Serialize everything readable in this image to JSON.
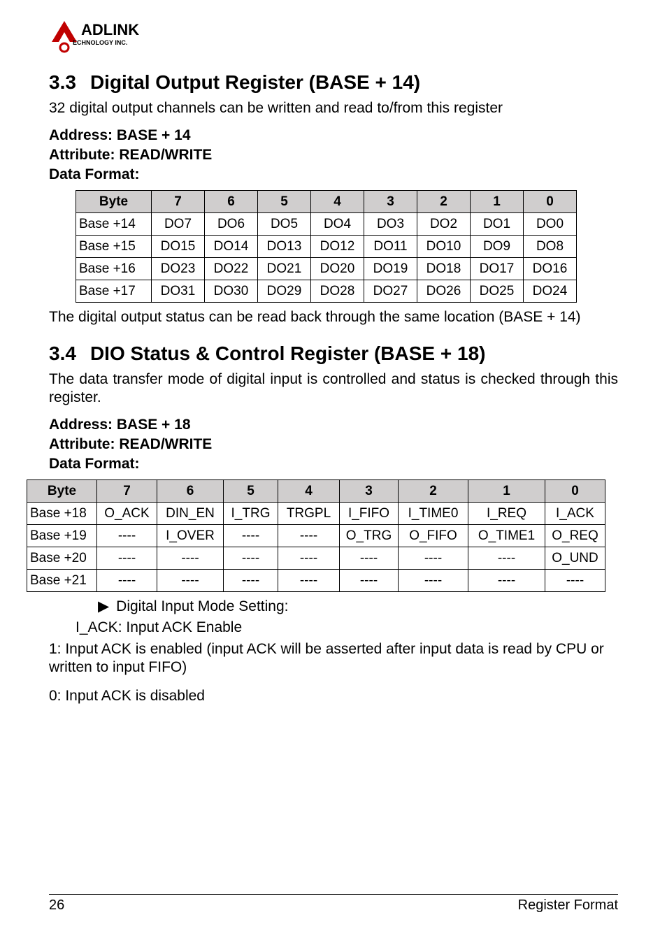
{
  "logo": {
    "line1": "ADLINK",
    "line2": "ECHNOLOGY INC."
  },
  "sec33": {
    "num": "3.3",
    "title": "Digital Output Register (BASE + 14)",
    "intro": "32 digital output channels can be written and read to/from this register",
    "addr_label": "Address: BASE + 14",
    "attr_label": "Attribute: READ/WRITE",
    "df_label": "Data Format:",
    "table_header": [
      "Byte",
      "7",
      "6",
      "5",
      "4",
      "3",
      "2",
      "1",
      "0"
    ],
    "rows": [
      [
        "Base +14",
        "DO7",
        "DO6",
        "DO5",
        "DO4",
        "DO3",
        "DO2",
        "DO1",
        "DO0"
      ],
      [
        "Base +15",
        "DO15",
        "DO14",
        "DO13",
        "DO12",
        "DO11",
        "DO10",
        "DO9",
        "DO8"
      ],
      [
        "Base +16",
        "DO23",
        "DO22",
        "DO21",
        "DO20",
        "DO19",
        "DO18",
        "DO17",
        "DO16"
      ],
      [
        "Base +17",
        "DO31",
        "DO30",
        "DO29",
        "DO28",
        "DO27",
        "DO26",
        "DO25",
        "DO24"
      ]
    ],
    "post": "The digital output status can be read back through the same location (BASE + 14)"
  },
  "sec34": {
    "num": "3.4",
    "title": "DIO Status & Control Register (BASE + 18)",
    "intro": "The data transfer mode of digital input is controlled and status is checked through this register.",
    "addr_label": "Address: BASE + 18",
    "attr_label": "Attribute: READ/WRITE",
    "df_label": "Data Format:",
    "table_header": [
      "Byte",
      "7",
      "6",
      "5",
      "4",
      "3",
      "2",
      "1",
      "0"
    ],
    "rows": [
      [
        "Base +18",
        "O_ACK",
        "DIN_EN",
        "I_TRG",
        "TRGPL",
        "I_FIFO",
        "I_TIME0",
        "I_REQ",
        "I_ACK"
      ],
      [
        "Base +19",
        "----",
        "I_OVER",
        "----",
        "----",
        "O_TRG",
        "O_FIFO",
        "O_TIME1",
        "O_REQ"
      ],
      [
        "Base +20",
        "----",
        "----",
        "----",
        "----",
        "----",
        "----",
        "----",
        "O_UND"
      ],
      [
        "Base +21",
        "----",
        "----",
        "----",
        "----",
        "----",
        "----",
        "----",
        "----"
      ]
    ],
    "bullet": "Digital Input Mode Setting:",
    "iack_label": "I_ACK: Input ACK Enable",
    "iack_1": "1: Input ACK is enabled (input ACK will be asserted after input data is read by CPU or written to input FIFO)",
    "iack_0": "0: Input ACK is disabled"
  },
  "footer": {
    "page": "26",
    "chapter": "Register Format"
  }
}
